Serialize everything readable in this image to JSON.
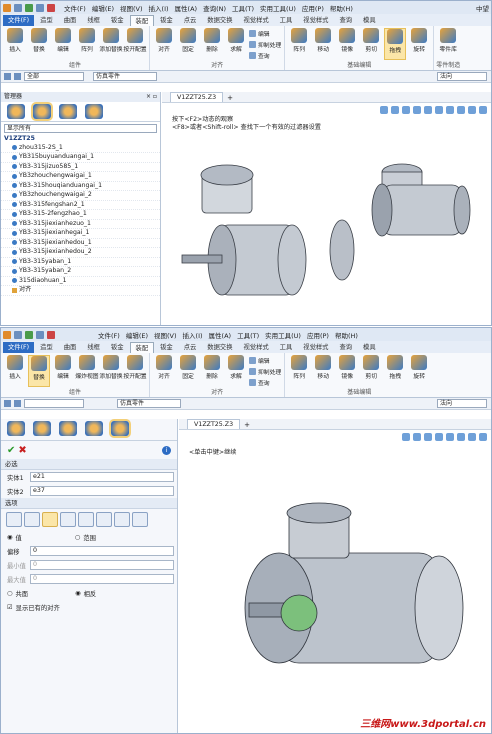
{
  "w1": {
    "menus": [
      "文件(F)",
      "编辑(E)",
      "视图(V)",
      "插入(I)",
      "属性(A)",
      "查询(N)",
      "工具(T)",
      "实用工具(U)",
      "应用(P)",
      "帮助(H)"
    ],
    "corner": "中望",
    "tabs": [
      "文件(F)",
      "造型",
      "曲面",
      "线框",
      "钣金",
      "装配",
      "钣金",
      "点云",
      "数据交换",
      "视觉样式",
      "工具",
      "视觉样式",
      "查询",
      "模具"
    ],
    "groups": [
      {
        "label": "组件",
        "btns": [
          "插入",
          "替换",
          "编辑",
          "阵列",
          "添加替换",
          "按开配置"
        ]
      },
      {
        "label": "对齐",
        "btns": [
          "对齐",
          "固定",
          "删除",
          "求解"
        ],
        "small": [
          "编辑",
          "抑制处理",
          "查询"
        ]
      },
      {
        "label": "基础编辑",
        "btns": [
          "阵列",
          "移动",
          "镜像",
          "剪切",
          "拖拽",
          "旋转"
        ]
      },
      {
        "label": "零件制造",
        "btns": [
          "零件库"
        ]
      }
    ],
    "sel_filter": "全部",
    "search": "仿真零件",
    "law": "法向",
    "panel_title": "管理器",
    "display": "显示所有",
    "root": "V1ZZT25",
    "items": [
      "zhou315-2S_1",
      "YB315buyuanduangai_1",
      "YB3-315jizuo585_1",
      "YB3zhouchengwaigai_1",
      "YB3-315houqianduangai_1",
      "YB3zhouchengwaigai_2",
      "YB3-315fengshan2_1",
      "YB3-315-2fengzhao_1",
      "YB3-315jiexianhezuo_1",
      "YB3-315jiexianhegai_1",
      "YB3-315jiexianhedou_1",
      "YB3-315jiexianhedou_2",
      "YB3-315yaban_1",
      "YB3-315yaban_2",
      "315diaohuan_1"
    ],
    "folder": "对齐",
    "doc": "V1ZZT25.Z3",
    "hint1": "按下<F2>动态的观察",
    "hint2": "<F8>或者<Shift-roll> 查找下一个有效的过滤器设置"
  },
  "w2": {
    "menus": [
      "文件(F)",
      "编辑(E)",
      "视图(V)",
      "插入(I)",
      "属性(A)",
      "工具(T)",
      "实用工具(U)",
      "应用(P)",
      "帮助(H)"
    ],
    "tabs": [
      "文件(F)",
      "造型",
      "曲面",
      "线框",
      "钣金",
      "装配",
      "钣金",
      "点云",
      "数据交换",
      "视觉样式",
      "工具",
      "视觉样式",
      "查询",
      "模具"
    ],
    "groups": [
      {
        "label": "组件",
        "btns": [
          "插入",
          "替换",
          "编辑",
          "爆炸视图",
          "添加替换",
          "按开配置"
        ]
      },
      {
        "label": "对齐",
        "btns": [
          "对齐",
          "固定",
          "删除",
          "求解"
        ],
        "small": [
          "编辑",
          "抑制处理",
          "查询"
        ]
      },
      {
        "label": "基础编辑",
        "btns": [
          "阵列",
          "移动",
          "镜像",
          "剪切",
          "拖拽",
          "旋转"
        ]
      }
    ],
    "search": "仿真零件",
    "law": "法向",
    "doc": "V1ZZT25.Z3",
    "hint": "<单击中键>继续",
    "required": "必选",
    "e1_label": "实体1",
    "e1": "e21",
    "e2_label": "实体2",
    "e2": "e37",
    "options": "选项",
    "radio1": "值",
    "radio2": "范围",
    "offset_label": "偏移",
    "offset": "0",
    "min_label": "最小值",
    "min": "0",
    "max_label": "最大值",
    "max": "0",
    "r3": "共面",
    "r4": "相反",
    "check": "显示已有的对齐"
  },
  "footer": "三维网www.3dportal.cn"
}
